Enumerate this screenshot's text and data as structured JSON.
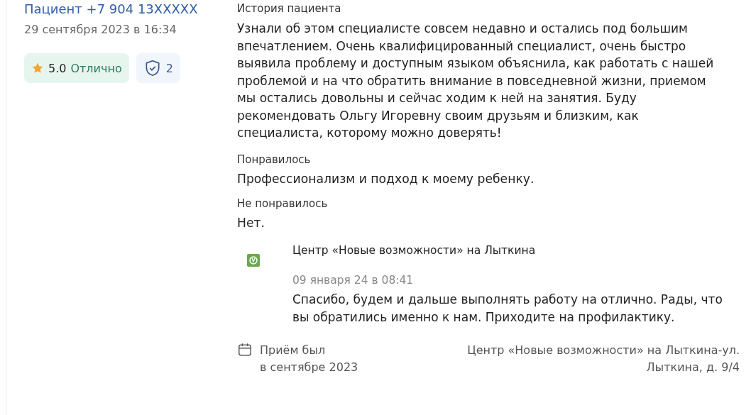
{
  "author": {
    "name": "Пациент +7 904 13XXXXX",
    "date": "29 сентября 2023 в 16:34"
  },
  "rating": {
    "score": "5.0",
    "label": "Отлично"
  },
  "verified": {
    "count": "2"
  },
  "review": {
    "heading": "История пациента",
    "text": "Узнали об этом специалисте совсем недавно и остались под большим впечатлением. Очень квалифицированный специалист, очень быстро выявила проблему и доступным языком объяснила, как работать с нашей проблемой и на что обратить внимание в повседневной жизни, приемом мы остались довольны и сейчас ходим к ней на занятия. Буду рекомендовать Ольгу Игоревну своим друзьям и близким, как специалиста, которому можно доверять!",
    "sections": [
      {
        "title": "Понравилось",
        "text": "Профессионализм и подход к моему ребенку."
      },
      {
        "title": "Не понравилось",
        "text": "Нет."
      }
    ]
  },
  "reply": {
    "clinic": "Центр «Новые возможности» на Лыткина",
    "date": "09 января 24 в 08:41",
    "text": "Спасибо, будем и дальше выполнять работу на отлично. Рады, что вы обратились именно к нам. Приходите на профилактику."
  },
  "visit": {
    "line1": "Приём был",
    "line2": "в сентябре 2023",
    "place1": "Центр «Новые возможности» на Лыткина-ул.",
    "place2": "Лыткина, д. 9/4"
  }
}
